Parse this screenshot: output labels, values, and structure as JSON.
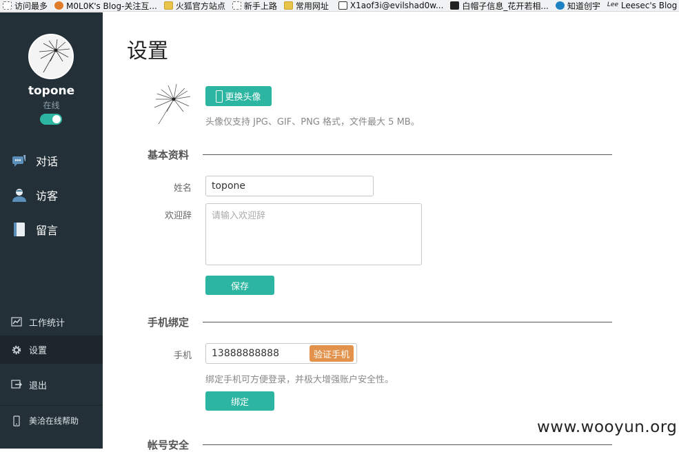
{
  "bookmarks": [
    {
      "label": "访问最多",
      "icon": "page-icon"
    },
    {
      "label": "M0L0K's Blog-关注互...",
      "icon": "fox-icon"
    },
    {
      "label": "火狐官方站点",
      "icon": "folder-icon"
    },
    {
      "label": "新手上路",
      "icon": "page-icon"
    },
    {
      "label": "常用网址",
      "icon": "folder-icon"
    },
    {
      "label": "X1aof3i@evilshad0w...",
      "icon": "doc-icon"
    },
    {
      "label": "白帽子信息_花开若相...",
      "icon": "dark-icon"
    },
    {
      "label": "知道创宇",
      "icon": "blue-icon"
    },
    {
      "label": "Leesec's Blog",
      "icon": "signature-icon"
    }
  ],
  "sidebar": {
    "username": "topone",
    "status": "在线",
    "online_toggle": true,
    "nav": [
      {
        "label": "对话",
        "icon": "chat-icon"
      },
      {
        "label": "访客",
        "icon": "visitor-icon"
      },
      {
        "label": "留言",
        "icon": "message-book-icon"
      }
    ],
    "bottom": [
      {
        "label": "工作统计",
        "icon": "chart-icon"
      },
      {
        "label": "设置",
        "icon": "gear-icon",
        "active": true
      },
      {
        "label": "退出",
        "icon": "logout-icon"
      },
      {
        "label": "美洽在线帮助",
        "icon": "phone-icon"
      }
    ]
  },
  "main": {
    "title": "设置",
    "avatar": {
      "button_label": "更换头像",
      "hint": "头像仅支持 JPG、GIF、PNG 格式，文件最大 5 MB。"
    },
    "basic": {
      "section_title": "基本资料",
      "name_label": "姓名",
      "name_value": "topone",
      "welcome_label": "欢迎辞",
      "welcome_placeholder": "请输入欢迎辞",
      "save_label": "保存"
    },
    "phone": {
      "section_title": "手机绑定",
      "phone_label": "手机",
      "phone_value": "13888888888",
      "verify_label": "验证手机",
      "hint": "绑定手机可方便登录，并极大增强账户安全性。",
      "bind_label": "绑定"
    },
    "account": {
      "section_title": "帐号安全"
    }
  },
  "watermark": "www.wooyun.org",
  "colors": {
    "sidebar_bg": "#243038",
    "accent": "#2cb5a0",
    "verify": "#e2924a"
  }
}
